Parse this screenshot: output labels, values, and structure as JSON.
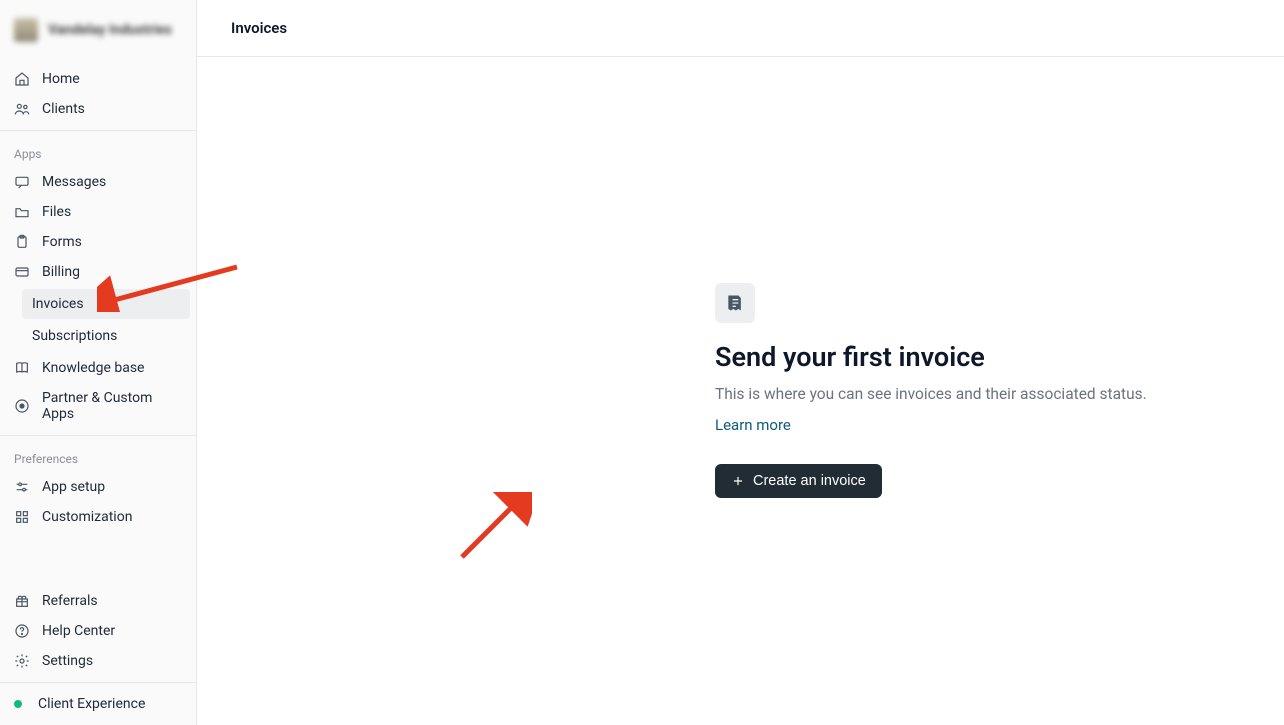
{
  "org": {
    "name": "Vandelay Industries"
  },
  "topbar": {
    "title": "Invoices"
  },
  "sidebar": {
    "main": [
      {
        "id": "home",
        "label": "Home",
        "icon": "home"
      },
      {
        "id": "clients",
        "label": "Clients",
        "icon": "users"
      }
    ],
    "apps_label": "Apps",
    "apps": [
      {
        "id": "messages",
        "label": "Messages",
        "icon": "chat"
      },
      {
        "id": "files",
        "label": "Files",
        "icon": "folder"
      },
      {
        "id": "forms",
        "label": "Forms",
        "icon": "clipboard"
      },
      {
        "id": "billing",
        "label": "Billing",
        "icon": "card",
        "children": [
          {
            "id": "invoices",
            "label": "Invoices",
            "active": true
          },
          {
            "id": "subscriptions",
            "label": "Subscriptions"
          }
        ]
      },
      {
        "id": "kb",
        "label": "Knowledge base",
        "icon": "book"
      },
      {
        "id": "partner",
        "label": "Partner & Custom Apps",
        "icon": "cube"
      }
    ],
    "prefs_label": "Preferences",
    "prefs": [
      {
        "id": "appsetup",
        "label": "App setup",
        "icon": "sliders"
      },
      {
        "id": "customization",
        "label": "Customization",
        "icon": "grid"
      }
    ],
    "footer": [
      {
        "id": "referrals",
        "label": "Referrals",
        "icon": "gift"
      },
      {
        "id": "help",
        "label": "Help Center",
        "icon": "question"
      },
      {
        "id": "settings",
        "label": "Settings",
        "icon": "gear"
      }
    ],
    "client_exp": {
      "label": "Client Experience"
    }
  },
  "empty": {
    "title": "Send your first invoice",
    "description": "This is where you can see invoices and their associated status.",
    "learn_more": "Learn more",
    "cta": "Create an invoice"
  }
}
